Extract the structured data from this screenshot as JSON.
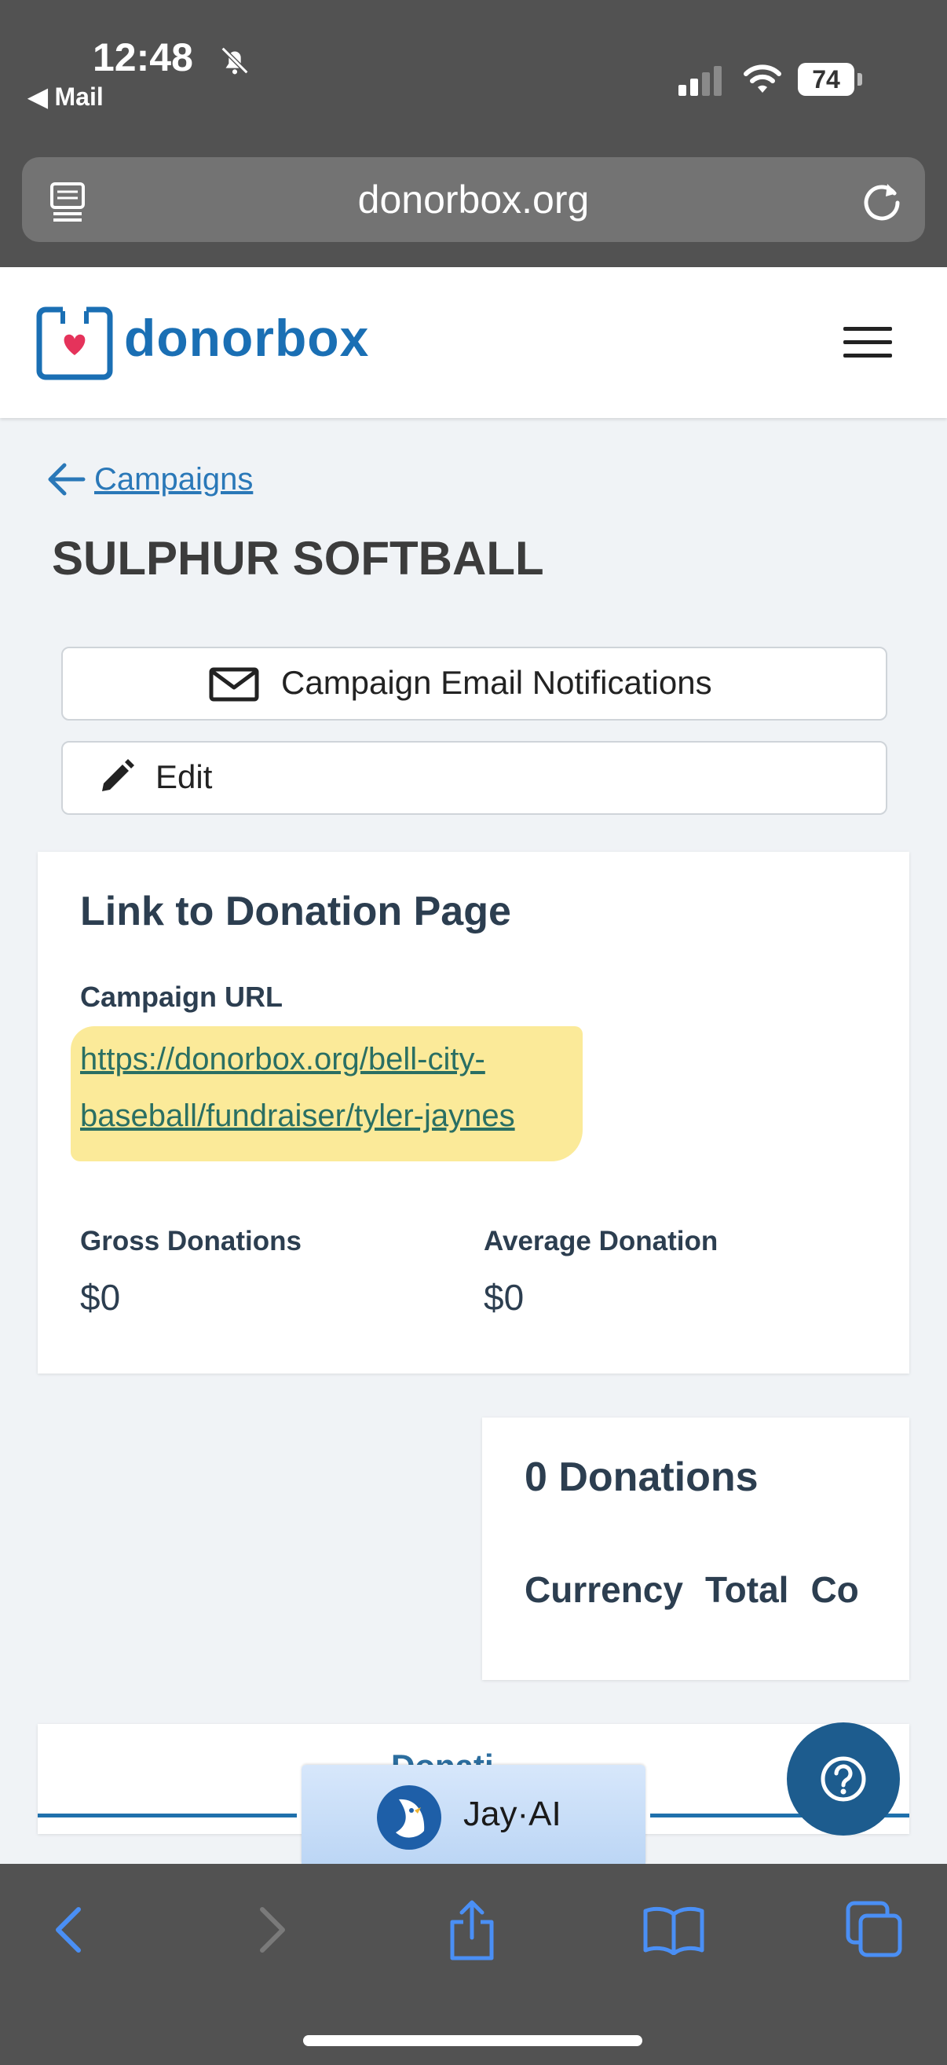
{
  "status_bar": {
    "time": "12:48",
    "back_app": "Mail",
    "battery": "74"
  },
  "browser": {
    "url": "donorbox.org"
  },
  "site": {
    "brand": "donorbox"
  },
  "nav": {
    "back_link": "Campaigns"
  },
  "campaign": {
    "title": "SULPHUR SOFTBALL",
    "buttons": {
      "email_notifications": "Campaign Email Notifications",
      "edit": "Edit"
    },
    "link_card": {
      "title": "Link to Donation Page",
      "url_label": "Campaign URL",
      "url_line1": "https://donorbox.org/bell-city-",
      "url_line2": "baseball/fundraiser/tyler-jaynes",
      "gross_label": "Gross Donations",
      "gross_value": "$0",
      "avg_label": "Average Donation",
      "avg_value": "$0"
    },
    "donations_card": {
      "count": "0 Donations",
      "headers": [
        "Currency",
        "Total",
        "Co"
      ]
    },
    "bottom_tab_partial": "Donati"
  },
  "assistant": {
    "label": "Jay·AI"
  },
  "colors": {
    "brand_blue": "#1a6fb4",
    "link_teal": "#2a6f63",
    "highlight": "#fbe88e",
    "help_button": "#1d5c8e",
    "safari_bar": "#525252"
  },
  "icons": [
    "bell-slash-icon",
    "signal-icon",
    "wifi-icon",
    "battery-icon",
    "reader-icon",
    "reload-icon",
    "menu-icon",
    "back-arrow-icon",
    "mail-icon",
    "pencil-icon",
    "help-icon",
    "back-icon",
    "forward-icon",
    "share-icon",
    "bookmarks-icon",
    "tabs-icon"
  ]
}
